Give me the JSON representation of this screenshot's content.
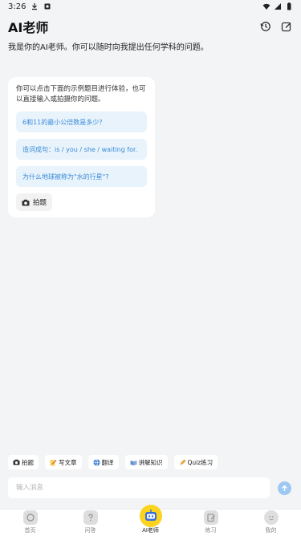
{
  "status_bar": {
    "time": "3:26"
  },
  "header": {
    "title": "AI老师"
  },
  "intro": "我是你的AI老师。你可以随时向我提出任何学科的问题。",
  "card": {
    "text": "你可以点击下面的示例题目进行体验，也可以直接输入或拍摄你的问题。",
    "suggestions": [
      "6和11的最小公倍数是多少?",
      "造词成句：is / you / she / waiting for.",
      "为什么地球被称为\"水的行星\"?"
    ],
    "photo_label": "拍题"
  },
  "tools": [
    {
      "label": "拍题",
      "icon": "camera-icon"
    },
    {
      "label": "写文章",
      "icon": "pencil-icon"
    },
    {
      "label": "翻译",
      "icon": "globe-icon"
    },
    {
      "label": "讲解知识",
      "icon": "book-icon"
    },
    {
      "label": "Quiz练习",
      "icon": "pencil-icon"
    }
  ],
  "input": {
    "placeholder": "输入消息"
  },
  "tabs": [
    {
      "label": "首页",
      "icon": "home-icon"
    },
    {
      "label": "问答",
      "icon": "question-icon"
    },
    {
      "label": "AI老师",
      "icon": "robot-icon"
    },
    {
      "label": "练习",
      "icon": "practice-icon"
    },
    {
      "label": "我的",
      "icon": "profile-icon"
    }
  ],
  "colors": {
    "accent": "#3a8ad6",
    "suggestion_bg": "#e8f3fc",
    "ai_badge": "#fcd31f",
    "send": "#9cc8f2"
  }
}
